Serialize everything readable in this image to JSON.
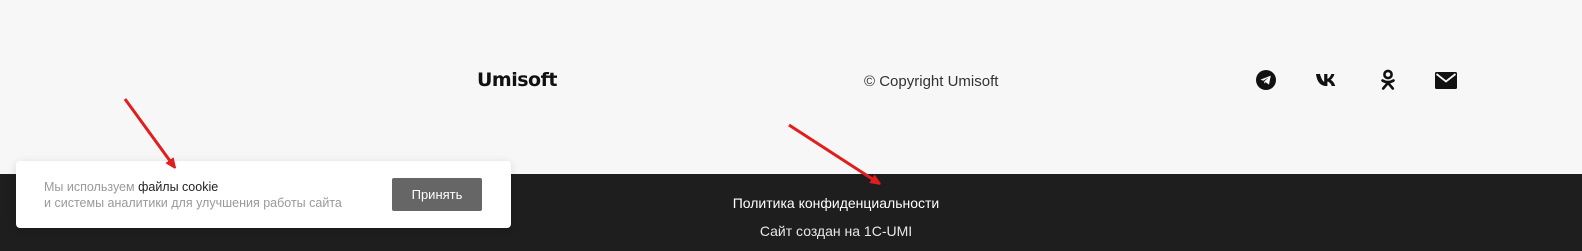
{
  "footer": {
    "logo": "Umisoft",
    "copyright": "© Copyright Umisoft",
    "social": [
      {
        "icon": "telegram-icon"
      },
      {
        "icon": "vk-icon"
      },
      {
        "icon": "odnoklassniki-icon"
      },
      {
        "icon": "mail-icon"
      }
    ],
    "privacy_link": "Политика конфиденциальности",
    "created_by": "Сайт создан на 1C-UMI"
  },
  "cookie_banner": {
    "text_prefix": "Мы используем ",
    "text_highlight": "файлы cookie",
    "text_line2": "и системы аналитики для улучшения работы сайта",
    "accept_label": "Принять"
  },
  "colors": {
    "page_bg": "#f7f7f7",
    "footer_bottom_bg": "#1e1e1e",
    "accept_button_bg": "#666666",
    "annotation_arrow": "#e11d1d"
  }
}
